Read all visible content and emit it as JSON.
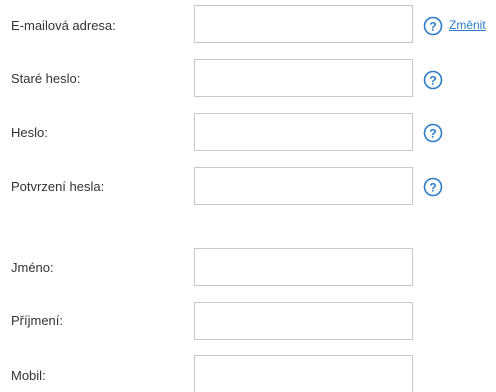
{
  "colors": {
    "accent": "#2b7dc7",
    "label_text": "#333333",
    "field_border": "#c8c8c8"
  },
  "account_section": {
    "email": {
      "label": "E-mailová adresa:",
      "value": "",
      "help_icon": "question-circle-icon",
      "change_link": "Změnit"
    },
    "old_password": {
      "label": "Staré heslo:",
      "value": "",
      "help_icon": "question-circle-icon"
    },
    "password": {
      "label": "Heslo:",
      "value": "",
      "help_icon": "question-circle-icon"
    },
    "password_confirm": {
      "label": "Potvrzení hesla:",
      "value": "",
      "help_icon": "question-circle-icon"
    }
  },
  "personal_section": {
    "first_name": {
      "label": "Jméno:",
      "value": ""
    },
    "last_name": {
      "label": "Příjmení:",
      "value": ""
    },
    "mobile": {
      "label": "Mobil:",
      "value": ""
    }
  }
}
